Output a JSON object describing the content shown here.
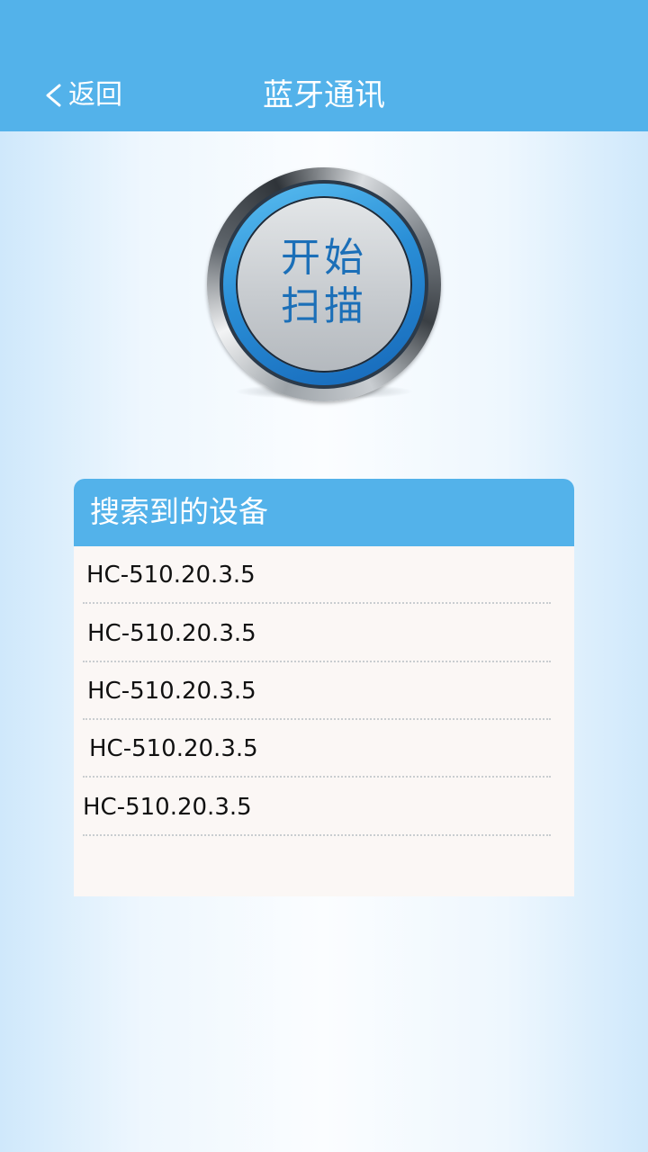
{
  "header": {
    "back_label": "返回",
    "title": "蓝牙通讯",
    "background": "#53b2ea"
  },
  "scan_button": {
    "line1": "开始",
    "line2": "扫描",
    "text_color": "#1b6fb8"
  },
  "device_panel": {
    "title": "搜索到的设备",
    "devices": [
      "HC-510.20.3.5",
      "HC-510.20.3.5",
      "HC-510.20.3.5",
      "HC-510.20.3.5",
      "HC-510.20.3.5"
    ]
  },
  "icons": {
    "back": "chevron-left-icon"
  }
}
